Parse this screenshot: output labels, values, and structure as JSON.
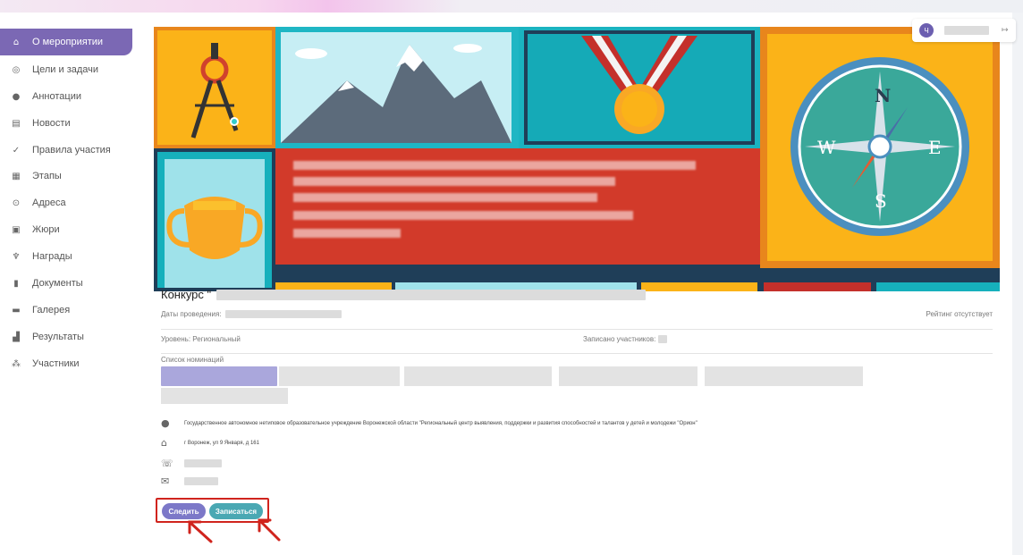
{
  "sidebar": {
    "items": [
      {
        "label": "О мероприятии",
        "icon": "home-icon",
        "glyph": "⌂",
        "active": true
      },
      {
        "label": "Цели и задачи",
        "icon": "target-icon",
        "glyph": "◎"
      },
      {
        "label": "Аннотации",
        "icon": "info-icon",
        "glyph": "●"
      },
      {
        "label": "Новости",
        "icon": "newspaper-icon",
        "glyph": "▤"
      },
      {
        "label": "Правила участия",
        "icon": "check-icon",
        "glyph": "✓"
      },
      {
        "label": "Этапы",
        "icon": "calendar-icon",
        "glyph": "▦"
      },
      {
        "label": "Адреса",
        "icon": "location-pin-icon",
        "glyph": "⊙"
      },
      {
        "label": "Жюри",
        "icon": "jury-icon",
        "glyph": "▣"
      },
      {
        "label": "Награды",
        "icon": "trophy-icon",
        "glyph": "♆"
      },
      {
        "label": "Документы",
        "icon": "document-icon",
        "glyph": "▮"
      },
      {
        "label": "Галерея",
        "icon": "gallery-icon",
        "glyph": "▬"
      },
      {
        "label": "Результаты",
        "icon": "bar-chart-icon",
        "glyph": "▟"
      },
      {
        "label": "Участники",
        "icon": "people-icon",
        "glyph": "⁂"
      }
    ]
  },
  "event": {
    "title": "Конкурс \"",
    "dates_label": "Даты проведения:",
    "rating": "Рейтинг отсутствует",
    "level": "Уровень: Региональный",
    "participants_label": "Записано участников:",
    "nominations_label": "Список номинаций"
  },
  "organizer": {
    "name": "Государственное автономное нетиповое образовательное учреждение Воронежской области \"Региональный центр выявления, поддержки и развития способностей и талантов у детей и молодежи \"Орион\"",
    "address": "г Воронеж, ул 9 Января, д 161"
  },
  "buttons": {
    "follow": "Следить",
    "signup": "Записаться"
  },
  "user": {
    "avatar_letter": "Ч"
  },
  "colors": {
    "accent": "#7b68b4",
    "follow_button": "#7c78c8",
    "signup_button": "#4aa8b3",
    "highlight": "#d0241d"
  }
}
